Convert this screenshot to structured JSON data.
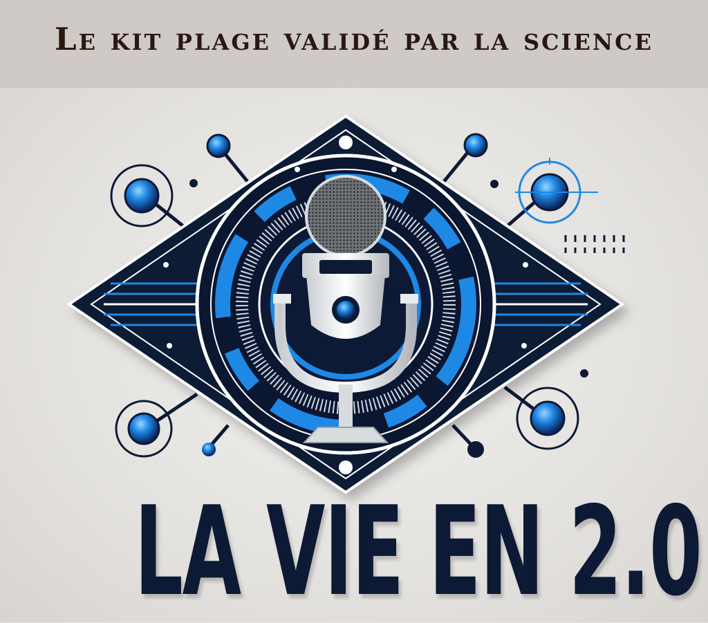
{
  "header": {
    "title": "Le kit plage validé par la science"
  },
  "logo": {
    "brand_name": "LA VIE EN 2.0",
    "center_icon": "microphone-icon",
    "colors": {
      "accent_blue": "#1e88e5",
      "dark_navy": "#0d1a35",
      "title_text": "#2a1810",
      "header_bg": "#cfcac5"
    }
  }
}
